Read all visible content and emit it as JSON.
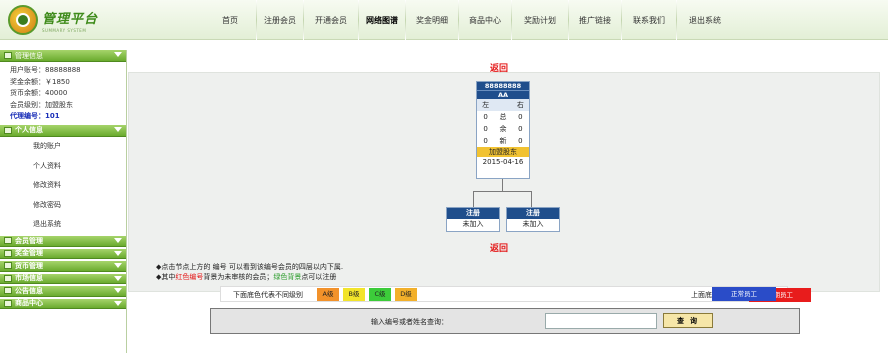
{
  "logo": {
    "title": "管理平台",
    "subtitle": "SUMMARY SYSTEM"
  },
  "nav": {
    "items": [
      {
        "label": "首页"
      },
      {
        "label": "注册会员"
      },
      {
        "label": "开通会员"
      },
      {
        "label": "网络图谱"
      },
      {
        "label": "奖金明细"
      },
      {
        "label": "商品中心"
      },
      {
        "label": "奖励计划"
      },
      {
        "label": "推广链接"
      },
      {
        "label": "联系我们"
      },
      {
        "label": "退出系统"
      }
    ],
    "active": "网络图谱"
  },
  "sidebar": {
    "manager_header": "管理信息",
    "account": "用户账号：88888888",
    "bonus": "奖金余额：￥1850",
    "coin": "货币余额：40000",
    "level": "会员级别：加盟股东",
    "agent": "代理编号：101",
    "personal_header": "个人信息",
    "personal_items": [
      "我的账户",
      "个人资料",
      "修改资料",
      "修改密码",
      "退出系统"
    ],
    "sections": [
      "会员管理",
      "奖金管理",
      "货币管理",
      "市场信息",
      "公告信息",
      "商品中心"
    ]
  },
  "tree": {
    "return_label": "返回",
    "root": {
      "id": "88888888",
      "name": "AA",
      "headers": [
        "左",
        "",
        "右"
      ],
      "rows": [
        [
          "0",
          "总",
          "0"
        ],
        [
          "0",
          "余",
          "0"
        ],
        [
          "0",
          "新",
          "0"
        ]
      ],
      "level": "加盟股东",
      "date": "2015-04-16"
    },
    "children": [
      {
        "title": "注册",
        "status": "未加入"
      },
      {
        "title": "注册",
        "status": "未加入"
      }
    ]
  },
  "notes": {
    "line1": "◆点击节点上方的 编号 可以看到该编号会员的四层以内下属.",
    "line2_prefix": "◆其中",
    "line2_red": "红色编号",
    "line2_mid": "背景为未审核的会员；",
    "line2_green": "绿色背景",
    "line2_suffix": "点可以注册"
  },
  "legend": {
    "label": "下面底色代表不同级别",
    "chips": [
      {
        "text": "A级",
        "color": "#f2922a"
      },
      {
        "text": "B级",
        "color": "#f2e42a"
      },
      {
        "text": "C级",
        "color": "#3ccc3a"
      },
      {
        "text": "D级",
        "color": "#f2b02a"
      }
    ],
    "right_label": "上面底色",
    "buttons": [
      {
        "text": "到期员工",
        "color": "#e81c1c"
      },
      {
        "text": "正常员工",
        "color": "#2a4cc8"
      }
    ]
  },
  "search": {
    "label": "输入编号或者姓名查询：",
    "value": "",
    "button": "查 询"
  }
}
